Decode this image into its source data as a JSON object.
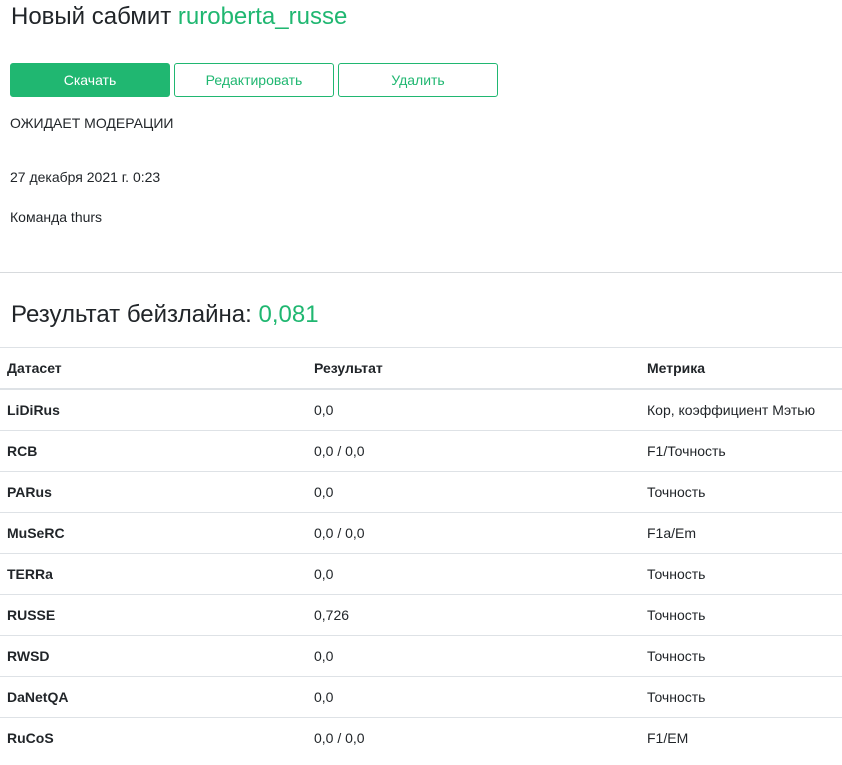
{
  "header": {
    "title_prefix": "Новый сабмит",
    "submission_name": "ruroberta_russe"
  },
  "actions": {
    "download_label": "Скачать",
    "edit_label": "Редактировать",
    "delete_label": "Удалить"
  },
  "submission": {
    "status": "ОЖИДАЕТ МОДЕРАЦИИ",
    "date": "27 декабря 2021 г. 0:23",
    "team": "Команда thurs"
  },
  "baseline": {
    "label": "Результат бейзлайна:",
    "value": "0,081"
  },
  "table": {
    "headers": [
      "Датасет",
      "Результат",
      "Метрика"
    ],
    "rows": [
      {
        "dataset": "LiDiRus",
        "result": "0,0",
        "metric": "Кор, коэффициент Мэтью"
      },
      {
        "dataset": "RCB",
        "result": "0,0 / 0,0",
        "metric": "F1/Точность"
      },
      {
        "dataset": "PARus",
        "result": "0,0",
        "metric": "Точность"
      },
      {
        "dataset": "MuSeRC",
        "result": "0,0 / 0,0",
        "metric": "F1a/Em"
      },
      {
        "dataset": "TERRa",
        "result": "0,0",
        "metric": "Точность"
      },
      {
        "dataset": "RUSSE",
        "result": "0,726",
        "metric": "Точность"
      },
      {
        "dataset": "RWSD",
        "result": "0,0",
        "metric": "Точность"
      },
      {
        "dataset": "DaNetQA",
        "result": "0,0",
        "metric": "Точность"
      },
      {
        "dataset": "RuCoS",
        "result": "0,0 / 0,0",
        "metric": "F1/EM"
      }
    ]
  },
  "colors": {
    "accent": "#20b771",
    "text": "#212529",
    "border": "#dee2e6"
  }
}
